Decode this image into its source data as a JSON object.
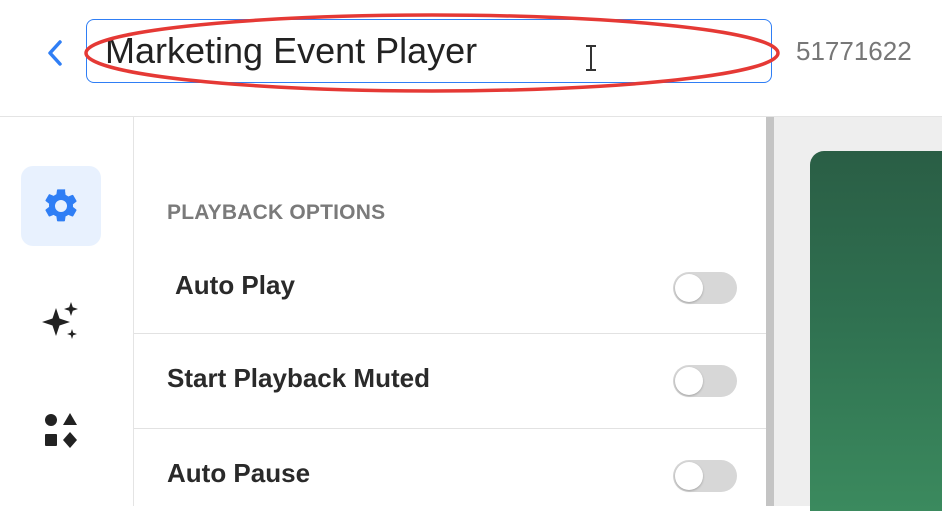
{
  "header": {
    "back_label": "<",
    "title_value": "Marketing Event Player",
    "id_text": "51771622"
  },
  "rail": {
    "items": [
      {
        "name": "settings",
        "icon": "gear-icon",
        "active": true
      },
      {
        "name": "ai",
        "icon": "sparkles-icon",
        "active": false
      },
      {
        "name": "elements",
        "icon": "shapes-icon",
        "active": false
      }
    ]
  },
  "panel": {
    "section_title": "PLAYBACK OPTIONS",
    "options": [
      {
        "label": "Auto Play",
        "enabled": false
      },
      {
        "label": "Start Playback Muted",
        "enabled": false
      },
      {
        "label": "Auto Pause",
        "enabled": false
      }
    ]
  },
  "colors": {
    "accent": "#2f7ef5",
    "annotation": "#e53935",
    "preview": "#2f7050"
  }
}
